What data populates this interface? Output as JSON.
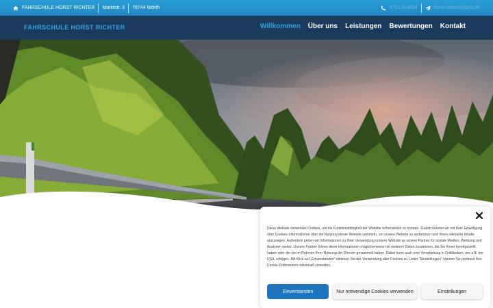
{
  "topbar": {
    "home_icon": "home-icon",
    "company": "FAHRSCHULE HORST RICHTER",
    "street": "Marktstr. 3",
    "city": "76744 Wörth",
    "phone_icon": "phone-icon",
    "phone": "0721 814654",
    "mail_icon": "paper-plane-icon",
    "email": "horst-richter@gmx.de"
  },
  "header": {
    "brand": "FAHRSCHULE HORST RICHTER",
    "nav": [
      "Willkommen",
      "Über uns",
      "Leistungen",
      "Bewertungen",
      "Kontakt"
    ],
    "active_index": 0
  },
  "hero": {
    "image": "forest-road-guardrail-photo"
  },
  "cookie": {
    "close_icon": "close-icon",
    "text": "Diese Website verwendet Cookies, um die Funktionsfähigkeit der Website sicherstellen zu können. Zudem können wir mit Ihrer Einwilligung über Cookies Informationen über die Nutzung dieser Website sammeln, um unsere Website zu verbessern und Ihnen relevante Inhalte anzuzeigen. Außerdem geben wir Informationen zu Ihrer Verwendung unserer Website an unsere Partner für soziale Medien, Werbung und Analysen weiter. Unsere Partner führen diese Informationen möglicherweise mit weiteren Daten zusammen, die Sie Ihnen bereitgestellt haben oder die sie im Rahmen Ihrer Nutzung der Dienste gesammelt haben. Dabei kann auch eine Verarbeitung in Drittländern, wie z.B. der USA, erfolgen. Mit Klick auf „Einverstanden\" stimmen Sie der Verwendung aller Cookies zu. Unter \"Einstellungen\" können Sie jederzeit Ihre Cookie Präferenzen individuell verwalten.",
    "accept": "Einverstanden",
    "necessary": "Nur notwendige Cookies verwenden",
    "settings": "Einstellungen"
  },
  "colors": {
    "topbar": "#2a9fd6",
    "header": "#1c3a5c",
    "accent": "#2ea6e5",
    "button_primary": "#1e73be"
  }
}
